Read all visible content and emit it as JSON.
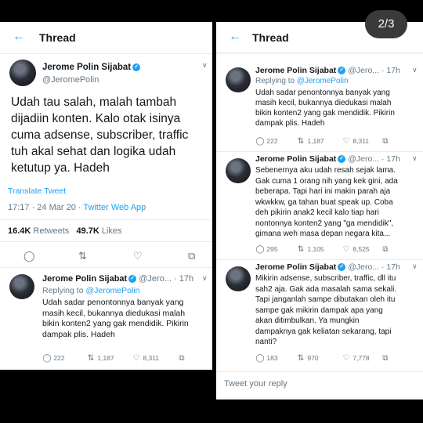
{
  "pager": "2/3",
  "left": {
    "header_title": "Thread",
    "main_tweet": {
      "name": "Jerome Polin Sijabat",
      "handle": "@JeromePolin",
      "text": "Udah tau salah, malah tambah\ndijadiin konten. Kalo otak isinya\ncuma adsense, subscriber, traffic\ntuh akal sehat dan logika udah\nketutup ya. Hadeh",
      "translate": "Translate Tweet",
      "time": "17:17 · 24 Mar 20 · ",
      "source": "Twitter Web App",
      "retweets_count": "16.4K",
      "retweets_label": "Retweets",
      "likes_count": "49.7K",
      "likes_label": "Likes"
    },
    "reply": {
      "name": "Jerome Polin Sijabat",
      "handle_time": "@Jero... · 17h",
      "replying_prefix": "Replying to ",
      "replying_to": "@JeromePolin",
      "text": "Udah sadar penontonnya banyak yang\nmasih kecil, bukannya diedukasi malah\nbikin konten2 yang gak mendidik. Pikirin\ndampak plis. Hadeh",
      "replies": "222",
      "retweets": "1,187",
      "likes": "8,311"
    }
  },
  "right": {
    "header_title": "Thread",
    "tweets": [
      {
        "name": "Jerome Polin Sijabat",
        "handle_time": "@Jero... · 17h",
        "replying_prefix": "Replying to ",
        "replying_to": "@JeromePolin",
        "text": "Udah sadar penontonnya banyak yang\nmasih kecil, bukannya diedukasi malah\nbikin konten2 yang gak mendidik. Pikirin\ndampak plis. Hadeh",
        "replies": "222",
        "retweets": "1,187",
        "likes": "8,311"
      },
      {
        "name": "Jerome Polin Sijabat",
        "handle_time": "@Jero... · 17h",
        "text": "Sebenernya aku udah resah sejak lama.\nGak cuma 1 orang nih yang kek gini, ada\nbeberapa. Tapi hari ini makin parah aja\nwkwkkw, ga tahan buat speak up. Coba\ndeh pikirin anak2 kecil kalo tiap hari\nnontonnya konten2 yang \"ga mendidik\",\ngimana weh masa depan negara kita...",
        "replies": "295",
        "retweets": "1,105",
        "likes": "8,525"
      },
      {
        "name": "Jerome Polin Sijabat",
        "handle_time": "@Jero... · 17h",
        "text": "Mikirin adsense, subscriber, traffic, dll itu\nsah2 aja. Gak ada masalah sama sekali.\nTapi janganlah sampe dibutakan oleh itu\nsampe gak mikirin dampak apa yang\nakan ditimbulkan. Ya mungkin\ndampaknya gak keliatan sekarang, tapi\nnanti?",
        "replies": "183",
        "retweets": "970",
        "likes": "7,778"
      }
    ],
    "reply_placeholder": "Tweet your reply"
  },
  "icons": {
    "back": "arrow-left-icon",
    "verified": "verified-badge-icon",
    "reply": "speech-bubble-icon",
    "retweet": "retweet-icon",
    "like": "heart-icon",
    "share": "share-icon",
    "chevron": "chevron-down-icon"
  },
  "colors": {
    "accent": "#1da1f2",
    "muted": "#657786",
    "text": "#14171a",
    "frame": "#000000",
    "pager_bg": "#3a3a3a"
  }
}
